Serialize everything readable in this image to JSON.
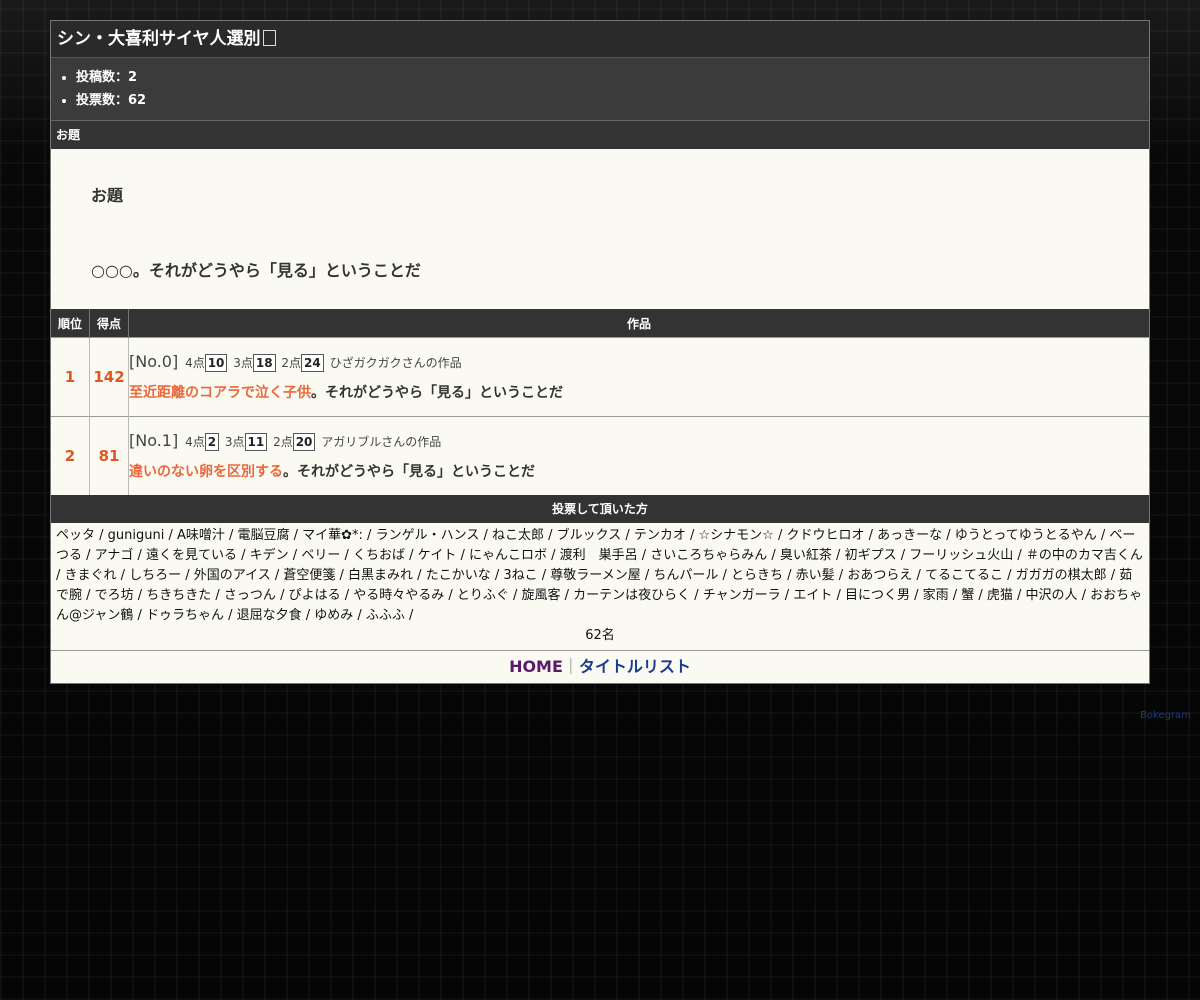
{
  "page": {
    "title": "シン・大喜利サイヤ人選別",
    "stats": [
      "投稿数：2",
      "投票数：62"
    ]
  },
  "odai": {
    "section_label": "お題",
    "heading": "お題",
    "text": "○○○。それがどうやら「見る」ということだ"
  },
  "results": {
    "headers": {
      "rank": "順位",
      "score": "得点",
      "work": "作品"
    },
    "rows": [
      {
        "rank": "1",
        "score": "142",
        "no": "[No.0]",
        "p4_label": "4点",
        "p4": "10",
        "p3_label": "3点",
        "p3": "18",
        "p2_label": "2点",
        "p2": "24",
        "author": "ひざガクガクさんの作品",
        "answer": "至近距離のコアラで泣く子供",
        "suffix": "。それがどうやら「見る」ということだ"
      },
      {
        "rank": "2",
        "score": "81",
        "no": "[No.1]",
        "p4_label": "4点",
        "p4": "2",
        "p3_label": "3点",
        "p3": "11",
        "p2_label": "2点",
        "p2": "20",
        "author": "アガリブルさんの作品",
        "answer": "違いのない卵を区別する",
        "suffix": "。それがどうやら「見る」ということだ"
      }
    ]
  },
  "voters": {
    "label": "投票して頂いた方",
    "list": "ペッタ / guniguni / A味噌汁 / 電脳豆腐 / マイ華✿*: / ランゲル・ハンス / ねこ太郎 / ブルックス / テンカオ / ☆シナモン☆ / クドウヒロオ / あっきーな / ゆうとってゆうとるやん / ベーつる / アナゴ / 遠くを見ている / キデン / ベリー / くちおば / ケイト / にゃんこロボ / 渡利　巣手呂 / さいころちゃらみん / 臭い紅茶 / 初ギプス / フーリッシュ火山 / ＃の中のカマ吉くん / きまぐれ / しちろー / 外国のアイス / 蒼空便箋 / 白黒まみれ / たこかいな / 3ねこ / 尊敬ラーメン屋 / ちんパール / とらきち / 赤い髪 / おあつらえ / てるこてるこ / ガガガの棋太郎 / 茹で腕 / でろ坊 / ちきちきた / さっつん / ぴよはる / やる時々やるみ / とりふぐ / 旋風客 / カーテンは夜ひらく / チャンガーラ / エイト / 目につく男 / 家雨 / 蟹 / 虎猫 / 中沢の人 / おおちゃん@ジャン鶴 / ドゥラちゃん / 退屈な夕食 / ゆめみ / ふふふ /",
    "count": "62名"
  },
  "footer": {
    "home": "HOME",
    "sep": "｜",
    "title_list": "タイトルリスト"
  },
  "credit": "Bokegram",
  "colors": {
    "accent": "#e0581e",
    "answer_highlight": "#e9683c",
    "home_link": "#5b1a6a",
    "title_list_link": "#1a3d8a"
  }
}
